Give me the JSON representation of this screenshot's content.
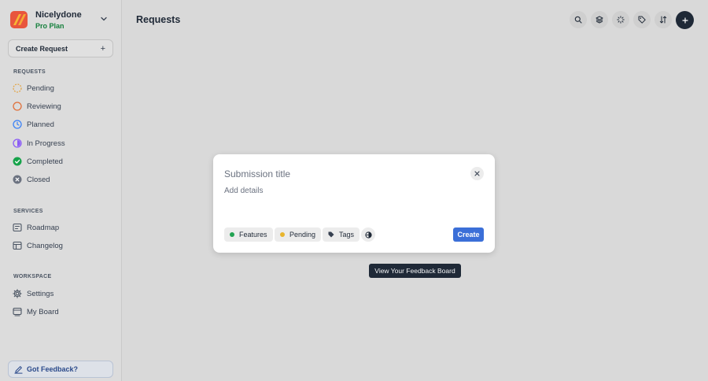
{
  "colors": {
    "background": "#d9d9d9",
    "accent": "#3b6fd8",
    "plan_green": "#16803d",
    "dark": "#1f2937"
  },
  "sidebar": {
    "org_name": "Nicelydone",
    "org_plan": "Pro Plan",
    "create_request_label": "Create Request",
    "sections": {
      "requests_label": "REQUESTS",
      "services_label": "SERVICES",
      "workspace_label": "WORKSPACE"
    },
    "requests": [
      {
        "label": "Pending",
        "icon": "pending-status-icon",
        "color": "#e2a64a"
      },
      {
        "label": "Reviewing",
        "icon": "reviewing-status-icon",
        "color": "#e0703a"
      },
      {
        "label": "Planned",
        "icon": "planned-clock-icon",
        "color": "#3b82f6"
      },
      {
        "label": "In Progress",
        "icon": "in-progress-status-icon",
        "color": "#8b5cf6"
      },
      {
        "label": "Completed",
        "icon": "completed-check-icon",
        "color": "#16a34a"
      },
      {
        "label": "Closed",
        "icon": "closed-x-icon",
        "color": "#6b7280"
      }
    ],
    "services": [
      {
        "label": "Roadmap",
        "icon": "roadmap-icon"
      },
      {
        "label": "Changelog",
        "icon": "changelog-icon"
      }
    ],
    "workspace": [
      {
        "label": "Settings",
        "icon": "settings-gear-icon"
      },
      {
        "label": "My Board",
        "icon": "board-icon"
      }
    ],
    "feedback_label": "Got Feedback?"
  },
  "header": {
    "title": "Requests",
    "tools": [
      "search-icon",
      "layers-icon",
      "loader-icon",
      "tag-icon",
      "sort-icon",
      "plus-icon"
    ]
  },
  "modal": {
    "title_placeholder": "Submission title",
    "details_placeholder": "Add details",
    "chips": {
      "board": "Features",
      "status": "Pending",
      "tags": "Tags"
    },
    "create_label": "Create"
  },
  "tooltip": {
    "text": "View Your Feedback Board"
  }
}
